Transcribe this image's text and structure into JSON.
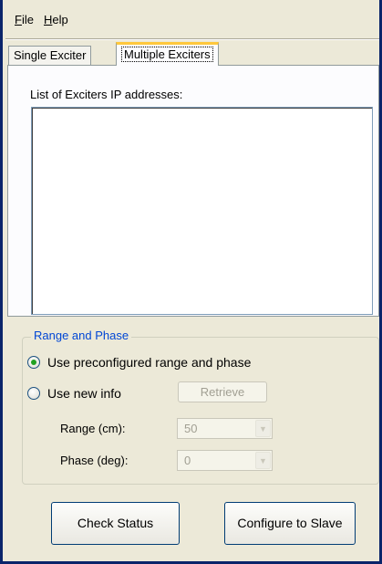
{
  "menu": {
    "file": {
      "accel": "F",
      "rest": "ile"
    },
    "help": {
      "accel": "H",
      "rest": "elp"
    }
  },
  "tabs": [
    {
      "label": "Single Exciter",
      "selected": false
    },
    {
      "label": "Multiple Exciters",
      "selected": true
    }
  ],
  "exciters": {
    "list_label": "List of Exciters IP addresses:",
    "items": []
  },
  "range_phase": {
    "title": "Range and Phase",
    "options": [
      {
        "label": "Use preconfigured range and phase",
        "checked": true
      },
      {
        "label": "Use new info",
        "checked": false
      }
    ],
    "retrieve_label": "Retrieve",
    "range_label": "Range (cm):",
    "range_value": "50",
    "phase_label": "Phase (deg):",
    "phase_value": "0"
  },
  "actions": {
    "check_status": "Check Status",
    "configure_slave": "Configure to Slave"
  },
  "colors": {
    "accent": "#0046d5",
    "tab_highlight": "#ffc83c",
    "radio_selected": "#21a121",
    "window_bg": "#ece9d8"
  }
}
